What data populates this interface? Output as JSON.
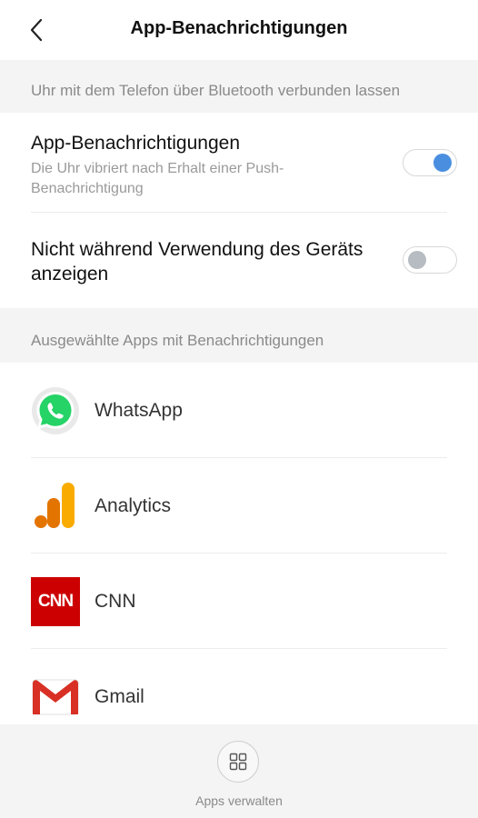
{
  "header": {
    "title": "App-Benachrichtigungen",
    "back_icon": "chevron-left-icon"
  },
  "section_bluetooth": {
    "label": "Uhr mit dem Telefon über Bluetooth verbunden lassen"
  },
  "settings": [
    {
      "label": "App-Benachrichtigungen",
      "description": "Die Uhr vibriert nach Erhalt einer Push-Benachrichtigung",
      "enabled": true
    },
    {
      "label": "Nicht während Verwendung des Geräts anzeigen",
      "enabled": false
    }
  ],
  "section_apps": {
    "label": "Ausgewählte Apps mit Benachrichtigungen"
  },
  "apps": [
    {
      "name": "WhatsApp",
      "icon": "whatsapp-icon"
    },
    {
      "name": "Analytics",
      "icon": "analytics-icon"
    },
    {
      "name": "CNN",
      "icon": "cnn-icon",
      "icon_text": "CNN"
    },
    {
      "name": "Gmail",
      "icon": "gmail-icon"
    }
  ],
  "footer": {
    "manage_label": "Apps verwalten",
    "manage_icon": "grid-icon"
  },
  "colors": {
    "accent": "#4a8fdf",
    "whatsapp": "#25d366",
    "cnn": "#cc0000",
    "gmail": "#d93025"
  }
}
